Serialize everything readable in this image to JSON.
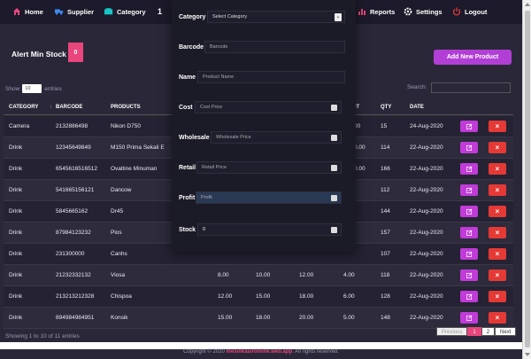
{
  "nav": {
    "home": "Home",
    "supplier": "Supplier",
    "category": "Category",
    "reports": "Reports",
    "settings": "Settings",
    "logout": "Logout"
  },
  "page": {
    "title": "Alert Min Stock",
    "badge": "0",
    "add_button": "Add New Product"
  },
  "table_controls": {
    "show": "Show",
    "show_value": "10",
    "entries": "entries",
    "search": "Search:"
  },
  "columns": [
    "CATEGORY",
    "BARCODE",
    "PRODUCTS",
    "IT",
    "QTY",
    "DATE"
  ],
  "rows": [
    {
      "category": "Camera",
      "barcode": "2132886498",
      "product": "Nikon D750",
      "c1": "",
      "c2": "",
      "c3": "",
      "c4": "00",
      "qty": "15",
      "date": "24-Aug-2020"
    },
    {
      "category": "Drink",
      "barcode": "12345649849",
      "product": "M150 Prima Sekali E",
      "c1": "",
      "c2": "",
      "c3": "",
      "c4": "0.00",
      "qty": "114",
      "date": "22-Aug-2020"
    },
    {
      "category": "Drink",
      "barcode": "6545616516512",
      "product": "Ovaltine Minuman",
      "c1": "",
      "c2": "",
      "c3": "",
      "c4": "0.00",
      "qty": "166",
      "date": "22-Aug-2020"
    },
    {
      "category": "Drink",
      "barcode": "541665156121",
      "product": "Dancow",
      "c1": "",
      "c2": "",
      "c3": "",
      "c4": "",
      "qty": "112",
      "date": "22-Aug-2020"
    },
    {
      "category": "Drink",
      "barcode": "5845665162",
      "product": "Dr45",
      "c1": "",
      "c2": "",
      "c3": "",
      "c4": "",
      "qty": "144",
      "date": "22-Aug-2020"
    },
    {
      "category": "Drink",
      "barcode": "87984123232",
      "product": "Pios",
      "c1": "",
      "c2": "",
      "c3": "",
      "c4": "",
      "qty": "157",
      "date": "22-Aug-2020"
    },
    {
      "category": "Drink",
      "barcode": "231300000",
      "product": "Canhs",
      "c1": "",
      "c2": "",
      "c3": "",
      "c4": "",
      "qty": "107",
      "date": "22-Aug-2020"
    },
    {
      "category": "Drink",
      "barcode": "21232332132",
      "product": "Viosa",
      "c1": "8.00",
      "c2": "10.00",
      "c3": "12.00",
      "c4": "4.00",
      "qty": "118",
      "date": "22-Aug-2020"
    },
    {
      "category": "Drink",
      "barcode": "213213212328",
      "product": "Chispoa",
      "c1": "12.00",
      "c2": "15.00",
      "c3": "18.00",
      "c4": "6.00",
      "qty": "128",
      "date": "22-Aug-2020"
    },
    {
      "category": "Drink",
      "barcode": "894984984951",
      "product": "Konsik",
      "c1": "15.00",
      "c2": "18.00",
      "c3": "20.00",
      "c4": "5.00",
      "qty": "148",
      "date": "22-Aug-2020"
    }
  ],
  "footer": {
    "info": "Showing 1 to 10 of 11 entries",
    "previous": "Previous",
    "page1": "1",
    "page2": "2",
    "next": "Next",
    "copyright_pre": "Copyright © 2020 ",
    "copyright_site": "mesinkasironline.web.app",
    "copyright_post": ". All rights reserved."
  },
  "modal": {
    "category_label": "Category",
    "category_value": "Select Category",
    "barcode_label": "Barcode",
    "barcode_ph": "Barcode",
    "name_label": "Name",
    "name_ph": "Product Name",
    "cost_label": "Cost",
    "cost_ph": "Cost Price",
    "wholesale_label": "Wholesale",
    "wholesale_ph": "Wholesale Price",
    "retail_label": "Retail",
    "retail_ph": "Retail Price",
    "profit_label": "Profit",
    "profit_ph": "Profit",
    "stock_label": "Stock",
    "stock_value": "0"
  }
}
